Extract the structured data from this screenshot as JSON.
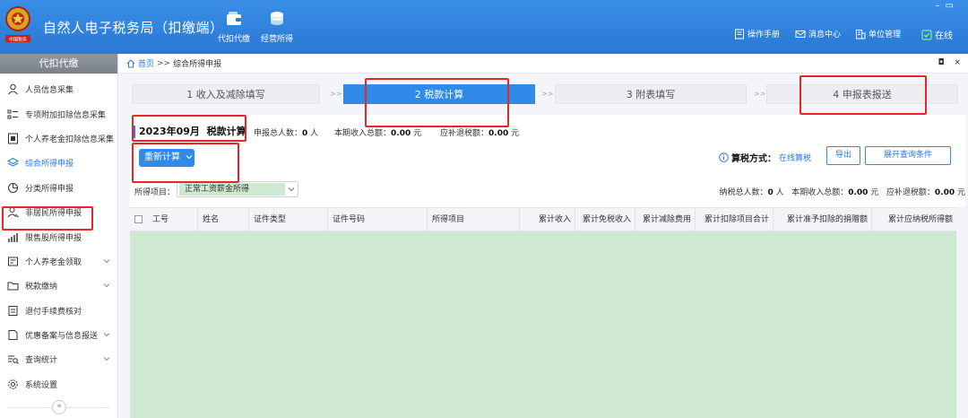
{
  "header": {
    "app_title": "自然人电子税务局（扣缴端）",
    "nav": [
      {
        "label": "代扣代缴",
        "icon": "wallet-icon"
      },
      {
        "label": "经营所得",
        "icon": "coins-icon"
      }
    ],
    "right_links": [
      {
        "label": "操作手册",
        "icon": "manual-icon"
      },
      {
        "label": "消息中心",
        "icon": "mail-icon"
      },
      {
        "label": "单位管理",
        "icon": "building-icon"
      },
      {
        "label": "在线",
        "icon": "online-check-icon"
      }
    ],
    "colors": {
      "brand": "#2a78d4",
      "highlight_red": "#e8262a",
      "accent_blue": "#2f8ae8",
      "table_green": "#cfe8d2"
    }
  },
  "sidebar": {
    "title": "代扣代缴",
    "items": [
      {
        "label": "人员信息采集",
        "icon": "person-icon"
      },
      {
        "label": "专项附加扣除信息采集",
        "icon": "list-icon"
      },
      {
        "label": "个人养老金扣除信息采集",
        "icon": "pension-doc-icon"
      },
      {
        "label": "综合所得申报",
        "icon": "layers-icon",
        "active": true
      },
      {
        "label": "分类所得申报",
        "icon": "pie-clock-icon"
      },
      {
        "label": "非居民所得申报",
        "icon": "user-outline-icon"
      },
      {
        "label": "限售股所得申报",
        "icon": "bar-signal-icon"
      },
      {
        "label": "个人养老金领取",
        "icon": "pension-icon",
        "expandable": true
      },
      {
        "label": "税款缴纳",
        "icon": "folder-icon",
        "expandable": true
      },
      {
        "label": "退付手续费核对",
        "icon": "receipt-icon"
      },
      {
        "label": "优惠备案与信息报送",
        "icon": "document-icon",
        "expandable": true
      },
      {
        "label": "查询统计",
        "icon": "query-icon",
        "expandable": true
      },
      {
        "label": "系统设置",
        "icon": "gear-icon"
      }
    ],
    "collapse_glyph": "«"
  },
  "breadcrumb": {
    "home": "首页",
    "sep": ">>",
    "current": "综合所得申报",
    "tab_controls": "◘ ×"
  },
  "steps": [
    {
      "label": "1 收入及减除填写"
    },
    {
      "label": "2 税款计算",
      "active": true
    },
    {
      "label": "3 附表填写"
    },
    {
      "label": "4 申报表报送"
    }
  ],
  "step_sep": ">>",
  "panel": {
    "period": "2023年09月",
    "title": "税款计算",
    "stats": [
      {
        "label": "申报总人数：",
        "value": "0",
        "unit": " 人"
      },
      {
        "label": "本期收入总额：",
        "value": "0.00",
        "unit": " 元"
      },
      {
        "label": "应补退税额：",
        "value": "0.00",
        "unit": " 元"
      }
    ],
    "recalc_label": "重新计算",
    "tax_mode_label": "算税方式：",
    "tax_mode_value": "在线算税",
    "export_label": "导出",
    "expand_label": "展开查询条件",
    "filter_label": "所得项目：",
    "filter_value": "正常工资薪金所得",
    "summary": [
      {
        "label": "纳税总人数：",
        "value": "0",
        "unit": " 人"
      },
      {
        "label": "本期收入总额：",
        "value": "0.00",
        "unit": " 元"
      },
      {
        "label": "应补退税额：",
        "value": "0.00",
        "unit": " 元"
      }
    ]
  },
  "table": {
    "columns": [
      "工号",
      "姓名",
      "证件类型",
      "证件号码",
      "所得项目",
      "累计收入",
      "累计免税收入",
      "累计减除费用",
      "累计扣除项目合计",
      "累计准予扣除的捐赠额",
      "累计应纳税所得额"
    ],
    "rows": []
  }
}
